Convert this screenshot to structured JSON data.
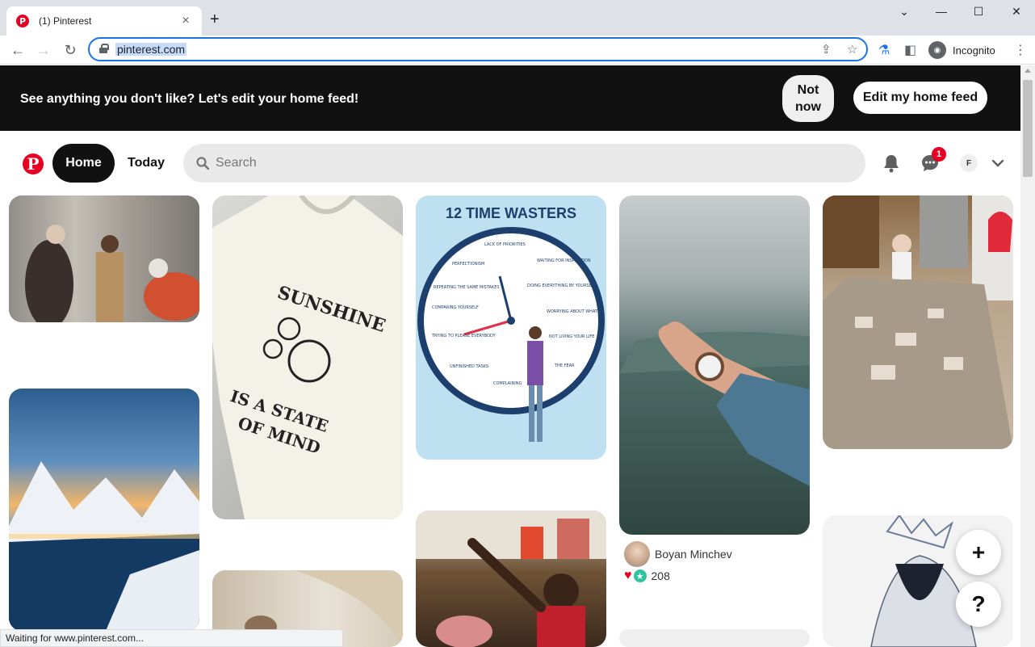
{
  "browser": {
    "tab_title": "(1) Pinterest",
    "url": "pinterest.com",
    "incognito_label": "Incognito"
  },
  "banner": {
    "text": "See anything you don't like? Let's edit your home feed!",
    "not_now_line1": "Not",
    "not_now_line2": "now",
    "edit_label": "Edit my home feed"
  },
  "header": {
    "home_label": "Home",
    "today_label": "Today",
    "search_placeholder": "Search",
    "notification_count": "1",
    "avatar_initial": "F"
  },
  "pins": {
    "clock_title": "12 TIME WASTERS",
    "shirt_line1": "SUNSHINE",
    "shirt_line2": "IS A STATE",
    "shirt_line3": "OF MIND",
    "author_name": "Boyan Minchev",
    "reaction_count": "208"
  },
  "status": "Waiting for www.pinterest.com...",
  "colors": {
    "brand": "#e60023",
    "banner_bg": "#111111",
    "accent": "#1a73e8"
  },
  "icons": [
    "pinterest-logo",
    "search-icon",
    "bell-icon",
    "messages-icon",
    "chevron-down-icon",
    "plus-icon",
    "help-icon"
  ]
}
